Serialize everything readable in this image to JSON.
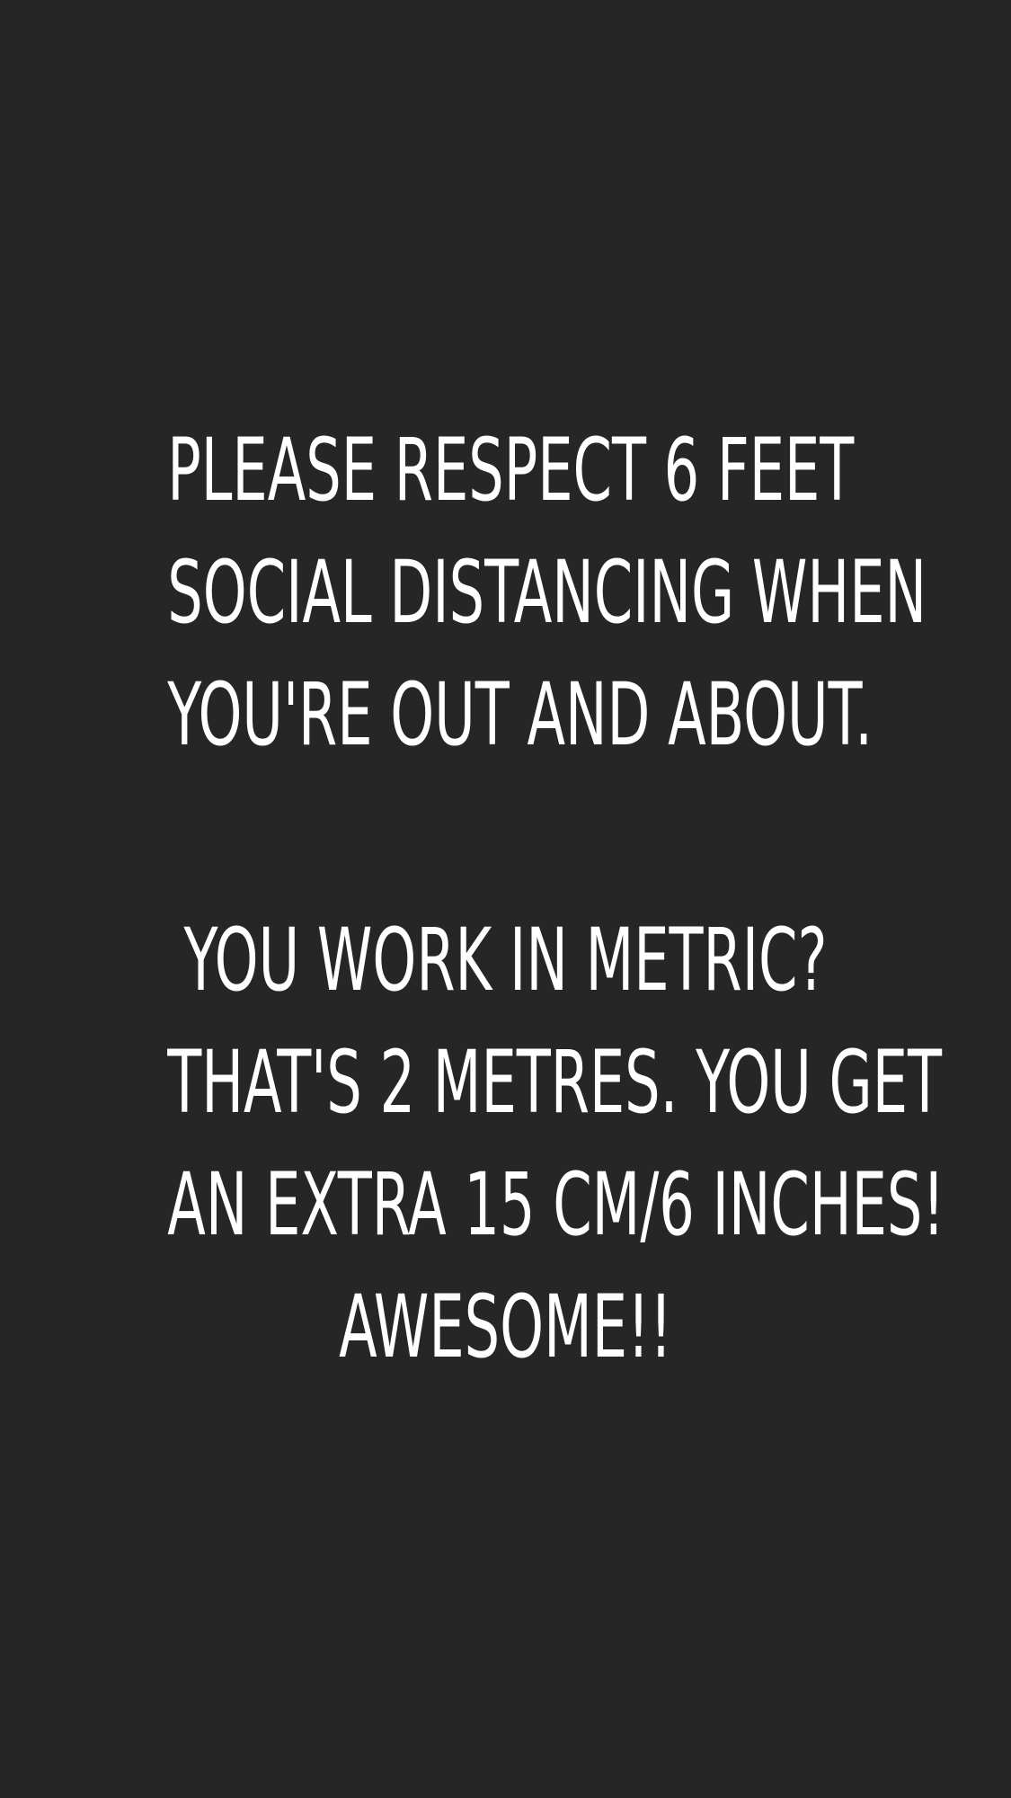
{
  "story": {
    "background_color": "#262626",
    "text_color": "#ffffff",
    "paragraph_1": [
      "PLEASE RESPECT 6 FEET",
      "SOCIAL DISTANCING WHEN",
      "YOU'RE OUT AND ABOUT."
    ],
    "paragraph_2": [
      "YOU WORK IN METRIC?",
      "THAT'S 2 METRES. YOU GET",
      "AN EXTRA 15 CM/6 INCHES!",
      "AWESOME!!"
    ]
  }
}
